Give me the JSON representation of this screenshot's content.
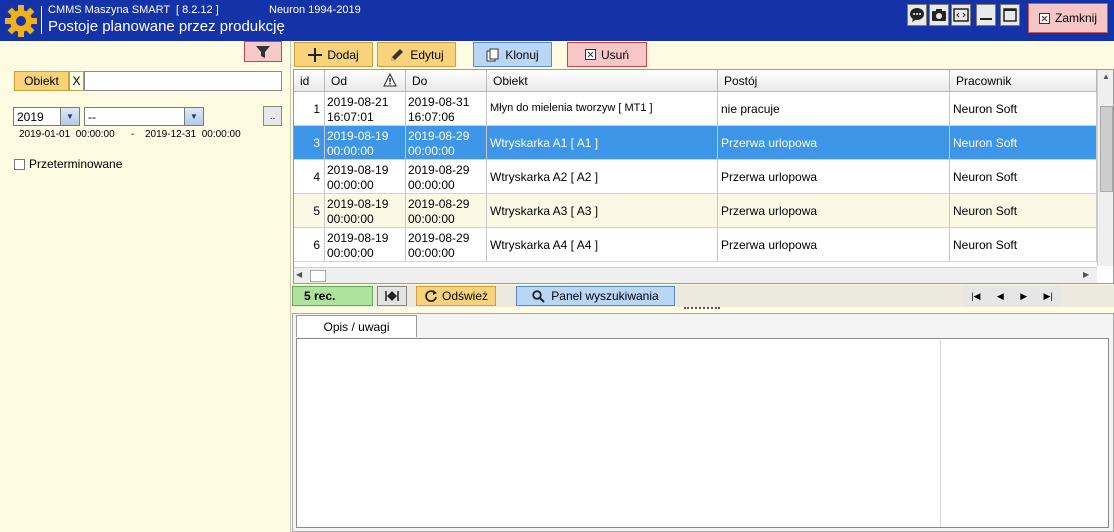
{
  "titlebar": {
    "app_name": "CMMS Maszyna SMART  [ 8.2.12 ]",
    "copyright": "Neuron 1994-2019",
    "window_title": "Postoje planowane przez produkcję",
    "close_label": "Zamknij",
    "accent": "#1533a8"
  },
  "filters": {
    "object_label": "Obiekt",
    "object_clear": "X",
    "object_value": "",
    "year": "2019",
    "month": "--",
    "range_button": "..",
    "date_from": "2019-01-01  00:00:00",
    "date_dash": "-",
    "date_to": "2019-12-31  00:00:00",
    "overdue_label": "Przeterminowane",
    "overdue_checked": false
  },
  "toolbar": {
    "add": "Dodaj",
    "edit": "Edytuj",
    "clone": "Klonuj",
    "delete": "Usuń"
  },
  "grid": {
    "columns": [
      "id",
      "Od",
      "Do",
      "Obiekt",
      "Postój",
      "Pracownik"
    ],
    "rows": [
      {
        "id": "1",
        "od1": "2019-08-21",
        "od2": "16:07:01",
        "do1": "2019-08-31",
        "do2": "16:07:06",
        "obiekt": "Młyn do mielenia tworzyw [ MT1 ]",
        "postoj": "nie pracuje",
        "pracownik": "Neuron Soft"
      },
      {
        "id": "3",
        "od1": "2019-08-19",
        "od2": "00:00:00",
        "do1": "2019-08-29",
        "do2": "00:00:00",
        "obiekt": "Wtryskarka A1 [ A1 ]",
        "postoj": "Przerwa urlopowa",
        "pracownik": "Neuron Soft"
      },
      {
        "id": "4",
        "od1": "2019-08-19",
        "od2": "00:00:00",
        "do1": "2019-08-29",
        "do2": "00:00:00",
        "obiekt": "Wtryskarka A2 [ A2 ]",
        "postoj": "Przerwa urlopowa",
        "pracownik": "Neuron Soft"
      },
      {
        "id": "5",
        "od1": "2019-08-19",
        "od2": "00:00:00",
        "do1": "2019-08-29",
        "do2": "00:00:00",
        "obiekt": "Wtryskarka A3 [ A3 ]",
        "postoj": "Przerwa urlopowa",
        "pracownik": "Neuron Soft"
      },
      {
        "id": "6",
        "od1": "2019-08-19",
        "od2": "00:00:00",
        "do1": "2019-08-29",
        "do2": "00:00:00",
        "obiekt": "Wtryskarka A4 [ A4 ]",
        "postoj": "Przerwa urlopowa",
        "pracownik": "Neuron Soft"
      }
    ],
    "selected_color": "#3d96e8"
  },
  "status": {
    "rec_count": "5 rec.",
    "refresh": "Odśwież",
    "search_panel": "Panel wyszukiwania"
  },
  "notes": {
    "tab_label": "Opis / uwagi"
  }
}
